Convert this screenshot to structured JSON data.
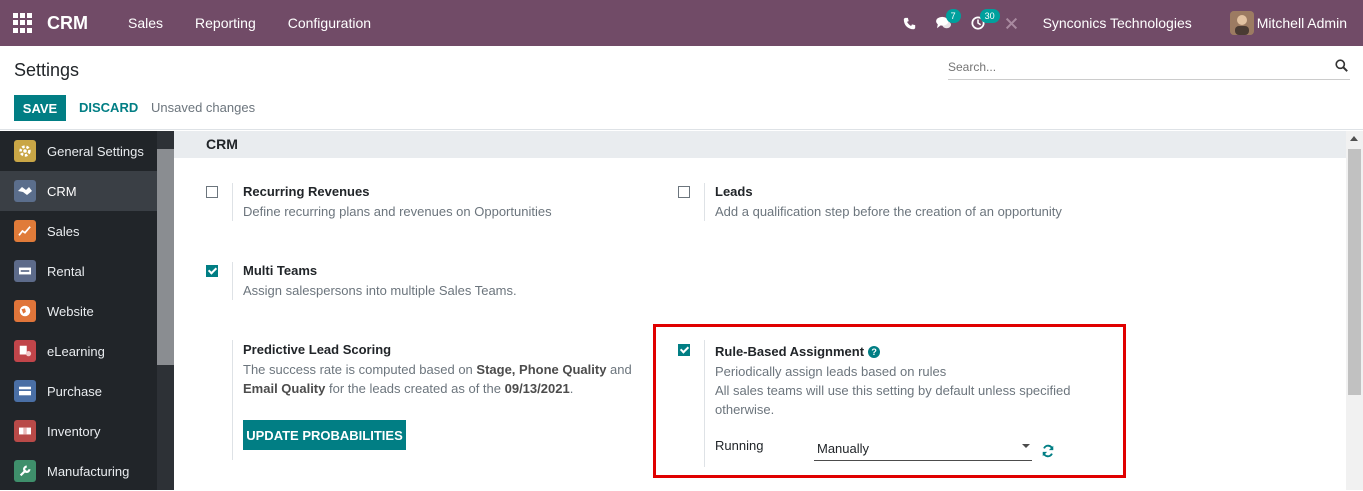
{
  "navbar": {
    "brand": "CRM",
    "menu": [
      "Sales",
      "Reporting",
      "Configuration"
    ],
    "chat_badge": "7",
    "activity_badge": "30",
    "company": "Synconics Technologies",
    "user": "Mitchell Admin"
  },
  "control": {
    "title": "Settings",
    "search_placeholder": "Search...",
    "save": "SAVE",
    "discard": "DISCARD",
    "status": "Unsaved changes"
  },
  "sidebar": {
    "items": [
      {
        "label": "General Settings",
        "icon": "gear-icon",
        "color": "#c9a646"
      },
      {
        "label": "CRM",
        "icon": "handshake-icon",
        "color": "#5b6e8c"
      },
      {
        "label": "Sales",
        "icon": "chart-icon",
        "color": "#e07b39"
      },
      {
        "label": "Rental",
        "icon": "rental-icon",
        "color": "#5d6b8a"
      },
      {
        "label": "Website",
        "icon": "globe-icon",
        "color": "#e0753a"
      },
      {
        "label": "eLearning",
        "icon": "elearning-icon",
        "color": "#c1454a"
      },
      {
        "label": "Purchase",
        "icon": "purchase-icon",
        "color": "#4a6fa5"
      },
      {
        "label": "Inventory",
        "icon": "inventory-icon",
        "color": "#b94a48"
      },
      {
        "label": "Manufacturing",
        "icon": "wrench-icon",
        "color": "#3f8f6b"
      }
    ]
  },
  "content": {
    "section": "CRM",
    "recurring": {
      "title": "Recurring Revenues",
      "desc": "Define recurring plans and revenues on Opportunities"
    },
    "leads": {
      "title": "Leads",
      "desc": "Add a qualification step before the creation of an opportunity"
    },
    "multi_teams": {
      "title": "Multi Teams",
      "desc": "Assign salespersons into multiple Sales Teams."
    },
    "predictive": {
      "title": "Predictive Lead Scoring",
      "desc_1": "The success rate is computed based on ",
      "desc_bold_1": "Stage, Phone Quality",
      "desc_2": " and ",
      "desc_bold_2": "Email Quality",
      "desc_3": " for the leads created as of the ",
      "desc_bold_3": "09/13/2021",
      "desc_4": ".",
      "button": "UPDATE PROBABILITIES"
    },
    "rule_based": {
      "title": "Rule-Based Assignment",
      "desc": "Periodically assign leads based on rules",
      "note": "All sales teams will use this setting by default unless specified otherwise.",
      "running_label": "Running",
      "running_value": "Manually"
    }
  },
  "colors": {
    "navbar": "#714b67",
    "primary": "#017e84",
    "highlight": "#e00000"
  }
}
